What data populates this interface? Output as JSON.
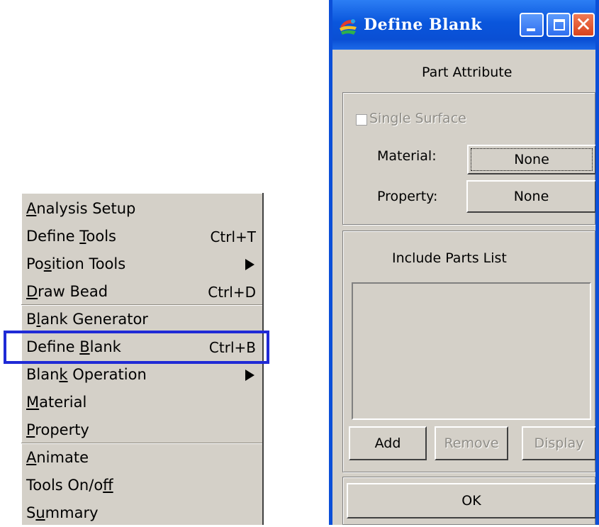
{
  "menu": {
    "items": [
      {
        "pre": "",
        "ul": "A",
        "post": "nalysis Setup",
        "shortcut": "",
        "submenu": false
      },
      {
        "pre": "Define ",
        "ul": "T",
        "post": "ools",
        "shortcut": "Ctrl+T",
        "submenu": false
      },
      {
        "pre": "Po",
        "ul": "s",
        "post": "ition Tools",
        "shortcut": "",
        "submenu": true
      },
      {
        "pre": "",
        "ul": "D",
        "post": "raw Bead",
        "shortcut": "Ctrl+D",
        "submenu": false
      },
      {
        "pre": "B",
        "ul": "l",
        "post": "ank Generator",
        "shortcut": "",
        "submenu": false
      },
      {
        "pre": "Define ",
        "ul": "B",
        "post": "lank",
        "shortcut": "Ctrl+B",
        "submenu": false
      },
      {
        "pre": "Blan",
        "ul": "k",
        "post": " Operation",
        "shortcut": "",
        "submenu": true
      },
      {
        "pre": "",
        "ul": "M",
        "post": "aterial",
        "shortcut": "",
        "submenu": false
      },
      {
        "pre": "",
        "ul": "P",
        "post": "roperty",
        "shortcut": "",
        "submenu": false
      },
      {
        "pre": "",
        "ul": "A",
        "post": "nimate",
        "shortcut": "",
        "submenu": false
      },
      {
        "pre": "Tools On/o",
        "ul": "f",
        "post": "f",
        "shortcut": "",
        "submenu": false
      },
      {
        "pre": "S",
        "ul": "u",
        "post": "mmary",
        "shortcut": "",
        "submenu": false
      }
    ],
    "highlighted": "Define Blank"
  },
  "dialog": {
    "title": "Define Blank",
    "part_attribute_label": "Part Attribute",
    "single_surface_label": "Single Surface",
    "material_label": "Material:",
    "material_value": "None",
    "property_label": "Property:",
    "property_value": "None",
    "include_parts_label": "Include Parts List",
    "add_label": "Add",
    "remove_label": "Remove",
    "display_label": "Display",
    "ok_label": "OK"
  },
  "colors": {
    "titlebar": "#0a56dc",
    "highlight_box": "#1f2ad6",
    "face": "#d4d0c8"
  }
}
